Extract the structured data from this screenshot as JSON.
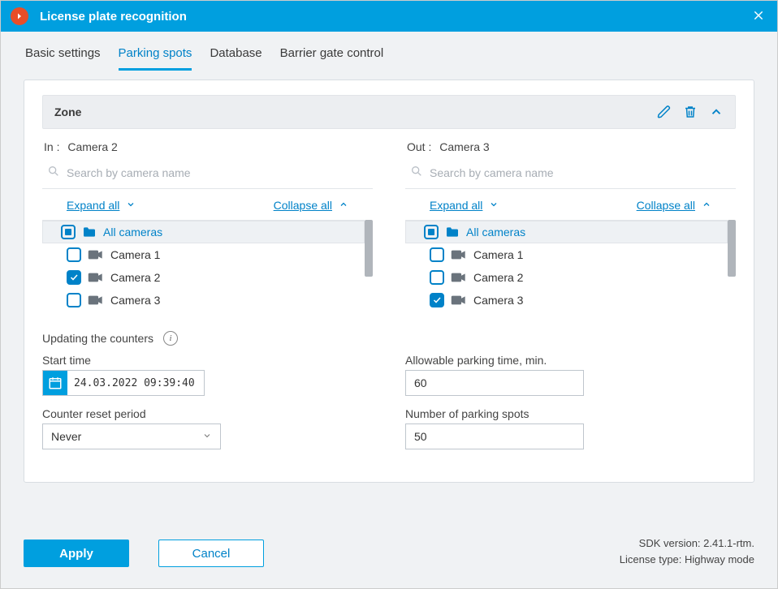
{
  "window": {
    "title": "License plate recognition"
  },
  "tabs": [
    {
      "label": "Basic settings",
      "active": false
    },
    {
      "label": "Parking spots",
      "active": true
    },
    {
      "label": "Database",
      "active": false
    },
    {
      "label": "Barrier gate control",
      "active": false
    }
  ],
  "zone": {
    "title": "Zone"
  },
  "in_panel": {
    "label_prefix": "In :",
    "selected": "Camera 2",
    "search_placeholder": "Search by camera name",
    "expand_label": "Expand all",
    "collapse_label": "Collapse all",
    "root_label": "All cameras",
    "root_state": "mixed",
    "items": [
      {
        "label": "Camera 1",
        "checked": false
      },
      {
        "label": "Camera 2",
        "checked": true
      },
      {
        "label": "Camera 3",
        "checked": false
      }
    ]
  },
  "out_panel": {
    "label_prefix": "Out :",
    "selected": "Camera 3",
    "search_placeholder": "Search by camera name",
    "expand_label": "Expand all",
    "collapse_label": "Collapse all",
    "root_label": "All cameras",
    "root_state": "mixed",
    "items": [
      {
        "label": "Camera 1",
        "checked": false
      },
      {
        "label": "Camera 2",
        "checked": false
      },
      {
        "label": "Camera 3",
        "checked": true
      }
    ]
  },
  "counters": {
    "heading": "Updating the counters",
    "start_time_label": "Start time",
    "start_time_value": "24.03.2022 09:39:40",
    "reset_label": "Counter reset period",
    "reset_value": "Never",
    "allowable_label": "Allowable parking time, min.",
    "allowable_value": "60",
    "spots_label": "Number of parking spots",
    "spots_value": "50"
  },
  "footer": {
    "apply": "Apply",
    "cancel": "Cancel",
    "sdk_line": "SDK version: 2.41.1-rtm.",
    "license_line": "License type: Highway mode"
  }
}
